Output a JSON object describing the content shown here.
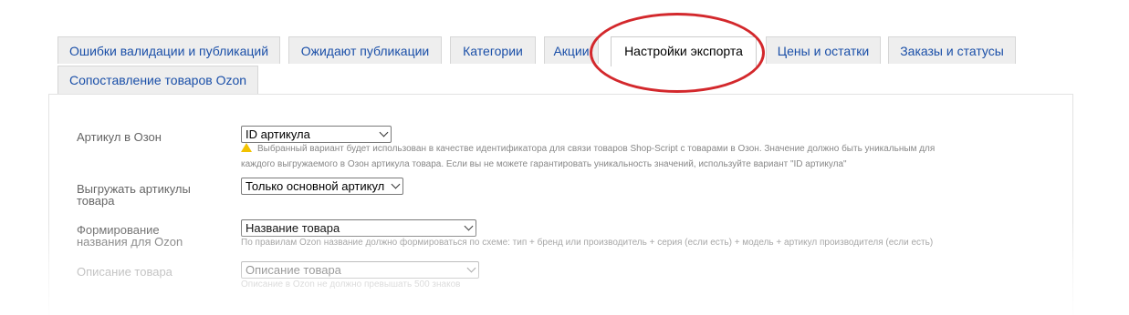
{
  "tabs": [
    {
      "label": "Ошибки валидации и публикаций"
    },
    {
      "label": "Ожидают публикации"
    },
    {
      "label": "Категории"
    },
    {
      "label": "Акции"
    },
    {
      "label": "Настройки экспорта",
      "active": true
    },
    {
      "label": "Цены и остатки"
    },
    {
      "label": "Заказы и статусы"
    },
    {
      "label": "Сопоставление товаров Ozon"
    }
  ],
  "colors": {
    "accent_link": "#1a4fa8",
    "highlight_ring": "#d3282c",
    "warning": "#f2c200"
  },
  "fields": {
    "article": {
      "label": "Артикул в Озон",
      "value": "ID артикула",
      "hint_line1": "Выбранный вариант будет использован в качестве идентификатора для связи товаров Shop-Script с товарами в Озон. Значение должно быть уникальным для",
      "hint_line2": "каждого выгружаемого в Озон артикула товара. Если вы не можете гарантировать уникальность значений, используйте вариант \"ID артикула\"",
      "hint_icon": "warning-icon"
    },
    "export_articles": {
      "label": "Выгружать артикулы товара",
      "value": "Только основной артикул"
    },
    "name_format": {
      "label": "Формирование названия для Ozon",
      "value": "Название товара",
      "hint": "По правилам Ozon название должно формироваться по схеме: тип + бренд или производитель + серия (если есть) + модель + артикул производителя (если есть)"
    },
    "description": {
      "label": "Описание товара",
      "value": "Описание товара",
      "hint": "Описание в Ozon не должно превышать 500 знаков"
    }
  }
}
